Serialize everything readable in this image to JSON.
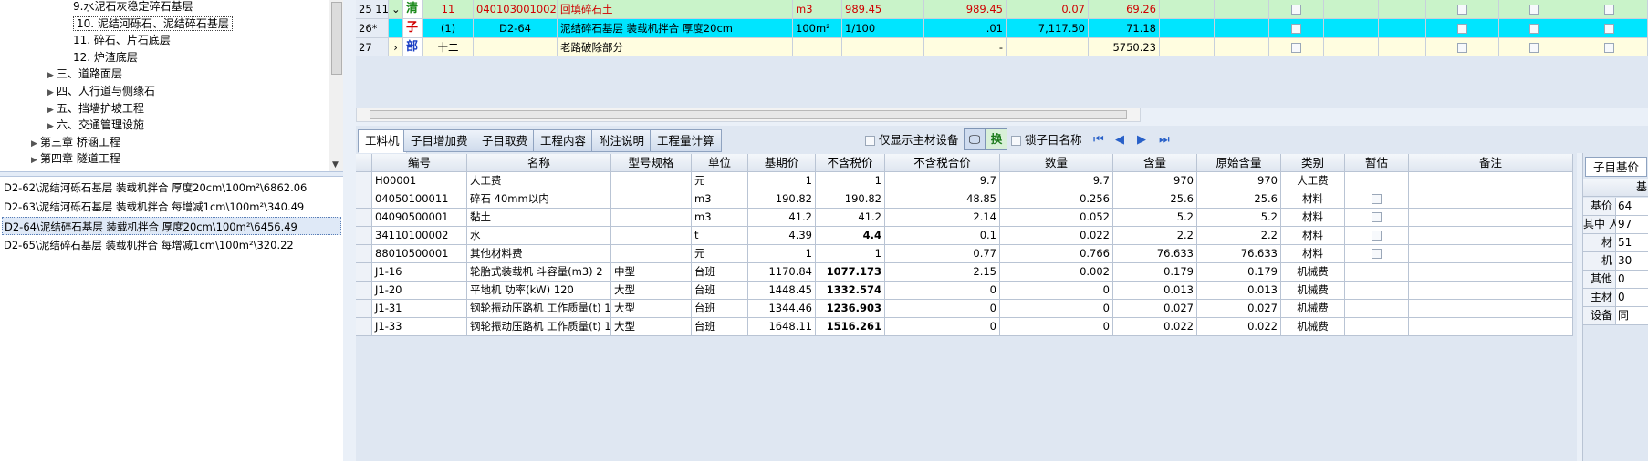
{
  "tree": {
    "items": [
      {
        "label": "9.水泥石灰稳定碎石基层",
        "indent": 3,
        "expander": ""
      },
      {
        "label": "10. 泥结河砾石、泥结碎石基层",
        "indent": 3,
        "expander": "",
        "selected": true
      },
      {
        "label": "11. 碎石、片石底层",
        "indent": 3,
        "expander": ""
      },
      {
        "label": "12. 炉渣底层",
        "indent": 3,
        "expander": ""
      },
      {
        "label": "三、道路面层",
        "indent": 2,
        "expander": "▶"
      },
      {
        "label": "四、人行道与侧缘石",
        "indent": 2,
        "expander": "▶"
      },
      {
        "label": "五、挡墙护坡工程",
        "indent": 2,
        "expander": "▶"
      },
      {
        "label": "六、交通管理设施",
        "indent": 2,
        "expander": "▶"
      },
      {
        "label": "第三章  桥涵工程",
        "indent": 1,
        "expander": "▶"
      },
      {
        "label": "第四章  隧道工程",
        "indent": 1,
        "expander": "▶"
      }
    ]
  },
  "quota_list": [
    {
      "text": "D2-62\\泥结河砾石基层 装载机拌合 厚度20cm\\100m²\\6862.06"
    },
    {
      "text": "D2-63\\泥结河砾石基层 装载机拌合 每增减1cm\\100m²\\340.49"
    },
    {
      "text": "D2-64\\泥结碎石基层 装载机拌合 厚度20cm\\100m²\\6456.49",
      "selected": true
    },
    {
      "text": "D2-65\\泥结碎石基层 装载机拌合 每增减1cm\\100m²\\320.22"
    }
  ],
  "top_grid": {
    "rows": [
      {
        "no": "25 11",
        "tog": "⌄",
        "type": "清",
        "id": "11",
        "code": "040103001002",
        "name": "回填碎石土",
        "unit": "m3",
        "qty": "989.45",
        "qty2": "989.45",
        "price": "0.07",
        "total": "69.26",
        "bg": "#c9f3c9",
        "color": "#d00000"
      },
      {
        "no": "26*",
        "tog": "",
        "type": "子",
        "id": "(1)",
        "code": "D2-64",
        "name": "泥结碎石基层 装载机拌合 厚度20cm",
        "unit": "100m²",
        "qty": "1/100",
        "qty2": ".01",
        "price": "7,117.50",
        "total": "71.18",
        "bg": "#00e5ff",
        "color": "#000000"
      },
      {
        "no": "27",
        "tog": "›",
        "type": "部",
        "id": "十二",
        "code": "",
        "name": "老路破除部分",
        "unit": "",
        "qty": "",
        "qty2": "-",
        "price": "",
        "total": "5750.23",
        "bg": "#fffde0",
        "color": "#000000"
      }
    ]
  },
  "tabs": [
    {
      "label": "工料机",
      "active": true
    },
    {
      "label": "子目增加费"
    },
    {
      "label": "子目取费"
    },
    {
      "label": "工程内容"
    },
    {
      "label": "附注说明"
    },
    {
      "label": "工程量计算"
    }
  ],
  "options": {
    "main_only": "仅显示主材设备",
    "swap": "换",
    "lock_name": "锁子目名称"
  },
  "grid": {
    "headers": [
      "编号",
      "名称",
      "型号规格",
      "单位",
      "基期价",
      "不含税价",
      "不含税合价",
      "数量",
      "含量",
      "原始含量",
      "类别",
      "暂估",
      "备注"
    ],
    "rows": [
      {
        "code": "H00001",
        "name": "人工费",
        "spec": "",
        "unit": "元",
        "base": "1",
        "price": "1",
        "sum": "9.7",
        "qty": "9.7",
        "content": "970",
        "orig": "970",
        "cat": "人工费",
        "est": false,
        "bold": false
      },
      {
        "code": "04050100011",
        "name": "碎石 40mm以内",
        "spec": "",
        "unit": "m3",
        "base": "190.82",
        "price": "190.82",
        "sum": "48.85",
        "qty": "0.256",
        "content": "25.6",
        "orig": "25.6",
        "cat": "材料",
        "est": true,
        "bold": false
      },
      {
        "code": "04090500001",
        "name": "黏土",
        "spec": "",
        "unit": "m3",
        "base": "41.2",
        "price": "41.2",
        "sum": "2.14",
        "qty": "0.052",
        "content": "5.2",
        "orig": "5.2",
        "cat": "材料",
        "est": true,
        "bold": false
      },
      {
        "code": "34110100002",
        "name": "水",
        "spec": "",
        "unit": "t",
        "base": "4.39",
        "price": "4.4",
        "sum": "0.1",
        "qty": "0.022",
        "content": "2.2",
        "orig": "2.2",
        "cat": "材料",
        "est": true,
        "bold": true
      },
      {
        "code": "88010500001",
        "name": "其他材料费",
        "spec": "",
        "unit": "元",
        "base": "1",
        "price": "1",
        "sum": "0.77",
        "qty": "0.766",
        "content": "76.633",
        "orig": "76.633",
        "cat": "材料",
        "est": true,
        "bold": false
      },
      {
        "code": "J1-16",
        "name": "轮胎式装载机 斗容量(m3) 2",
        "spec": "中型",
        "unit": "台班",
        "base": "1170.84",
        "price": "1077.173",
        "sum": "2.15",
        "qty": "0.002",
        "content": "0.179",
        "orig": "0.179",
        "cat": "机械费",
        "est": false,
        "bold": true
      },
      {
        "code": "J1-20",
        "name": "平地机 功率(kW) 120",
        "spec": "大型",
        "unit": "台班",
        "base": "1448.45",
        "price": "1332.574",
        "sum": "0",
        "qty": "0",
        "content": "0.013",
        "orig": "0.013",
        "cat": "机械费",
        "est": false,
        "bold": true
      },
      {
        "code": "J1-31",
        "name": "钢轮振动压路机 工作质量(t) 12",
        "spec": "大型",
        "unit": "台班",
        "base": "1344.46",
        "price": "1236.903",
        "sum": "0",
        "qty": "0",
        "content": "0.027",
        "orig": "0.027",
        "cat": "机械费",
        "est": false,
        "bold": true
      },
      {
        "code": "J1-33",
        "name": "钢轮振动压路机 工作质量(t) 15",
        "spec": "大型",
        "unit": "台班",
        "base": "1648.11",
        "price": "1516.261",
        "sum": "0",
        "qty": "0",
        "content": "0.022",
        "orig": "0.022",
        "cat": "机械费",
        "est": false,
        "bold": true
      }
    ]
  },
  "right_panel": {
    "tab": "子目基价",
    "header": "基",
    "rows": [
      {
        "label": "基价",
        "value": "64"
      },
      {
        "label": "其中 人",
        "value": "97"
      },
      {
        "label": "材",
        "value": "51"
      },
      {
        "label": "机",
        "value": "30"
      },
      {
        "label": "其他",
        "value": "0"
      },
      {
        "label": "主材",
        "value": "0"
      },
      {
        "label": "设备",
        "value": "同"
      }
    ]
  }
}
